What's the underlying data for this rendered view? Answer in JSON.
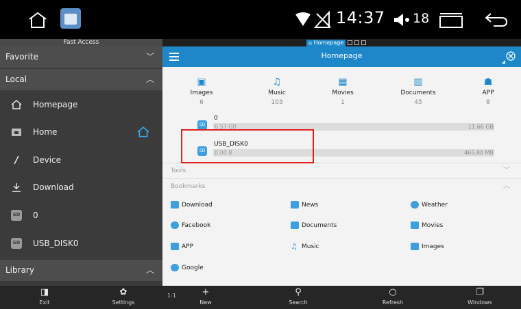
{
  "status_bar": {
    "time": "14:37",
    "volume": "18",
    "icons": [
      "home-icon",
      "app-icon",
      "wifi-icon",
      "signal-icon",
      "volume-icon",
      "window-icon",
      "back-icon"
    ]
  },
  "fast_access": {
    "title": "Fast Access"
  },
  "tab_strip": {
    "active_tab": "Homepage"
  },
  "sidebar": {
    "favorite": "Favorite",
    "local": "Local",
    "library": "Library",
    "items": [
      {
        "label": "Homepage",
        "icon": "home-outline-icon"
      },
      {
        "label": "Home",
        "icon": "folder-icon"
      },
      {
        "label": "Device",
        "icon": "slash-icon"
      },
      {
        "label": "Download",
        "icon": "download-icon"
      },
      {
        "label": "0",
        "icon": "sd-card-icon"
      },
      {
        "label": "USB_DISK0",
        "icon": "sd-card-icon"
      }
    ]
  },
  "main": {
    "title": "Homepage",
    "categories": [
      {
        "label": "Images",
        "count": "6"
      },
      {
        "label": "Music",
        "count": "103"
      },
      {
        "label": "Movies",
        "count": "1"
      },
      {
        "label": "Documents",
        "count": "45"
      },
      {
        "label": "APP",
        "count": "8"
      }
    ],
    "storages": [
      {
        "name": "0",
        "used": "6.57 GB",
        "total": "11.66 GB",
        "used_fraction": 0.56
      },
      {
        "name": "USB_DISK0",
        "used": "0.00 B",
        "total": "465.80 MB",
        "used_fraction": 0.0
      }
    ],
    "tools_label": "Tools",
    "bookmarks_label": "Bookmarks",
    "bookmarks": [
      {
        "label": "Download",
        "color": "#3b9fe0"
      },
      {
        "label": "News",
        "color": "#3b9fe0"
      },
      {
        "label": "Weather",
        "color": "#3b9fe0"
      },
      {
        "label": "Facebook",
        "color": "#3b9fe0"
      },
      {
        "label": "Documents",
        "color": "#3b9fe0"
      },
      {
        "label": "Movies",
        "color": "#3b9fe0"
      },
      {
        "label": "APP",
        "color": "#3b9fe0"
      },
      {
        "label": "Music",
        "color": "#3b9fe0"
      },
      {
        "label": "Images",
        "color": "#3b9fe0"
      },
      {
        "label": "Google",
        "color": "#3b9fe0"
      }
    ]
  },
  "toolbar": {
    "exit": "Exit",
    "settings": "Settings",
    "new": "New",
    "search": "Search",
    "refresh": "Refresh",
    "windows": "Windows",
    "zoom_label": "1:1"
  },
  "colors": {
    "accent": "#1d87c9",
    "sidebar": "#3b3b3b",
    "highlight": "#e02020"
  }
}
